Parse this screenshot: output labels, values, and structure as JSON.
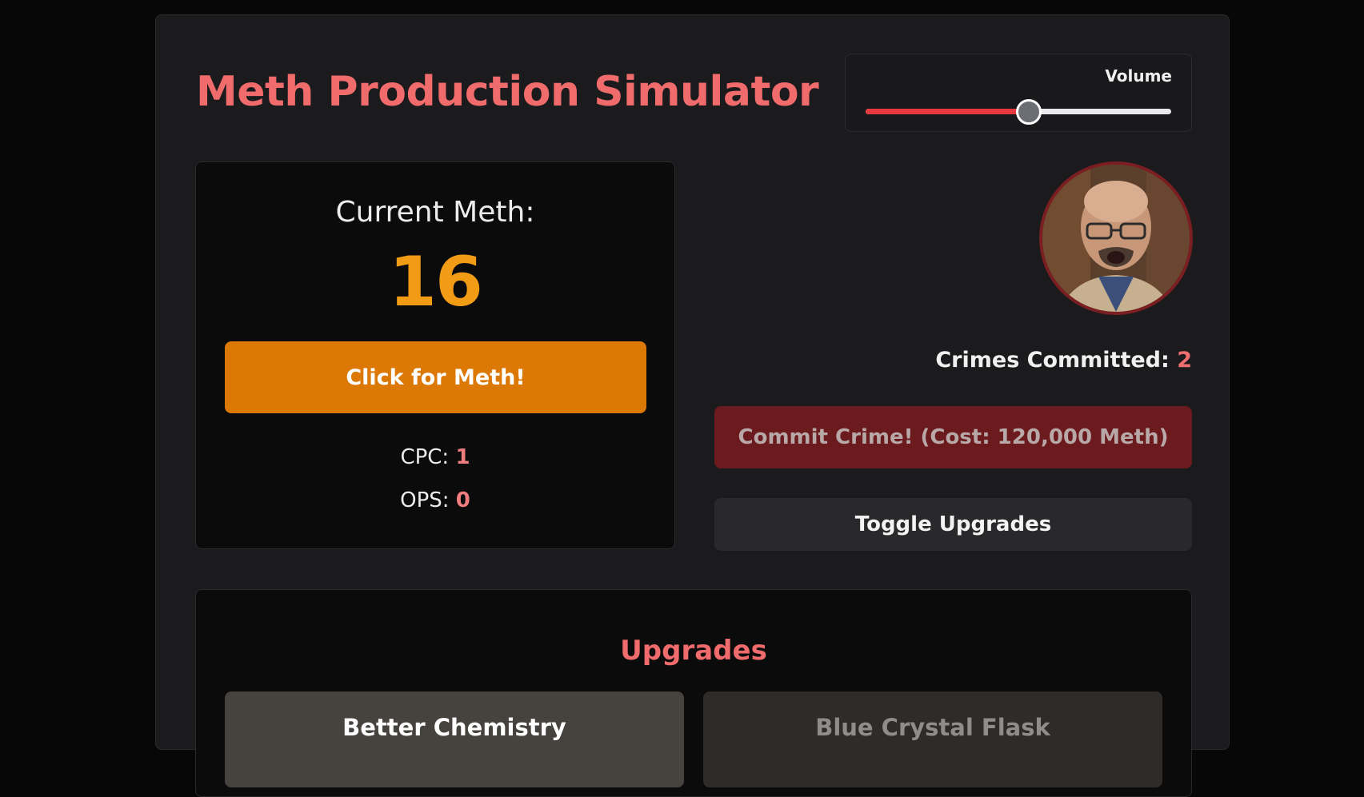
{
  "header": {
    "title": "Meth Production Simulator"
  },
  "volume": {
    "label": "Volume",
    "level": 0.53,
    "fill_color": "#e8393f"
  },
  "meth": {
    "label": "Current Meth:",
    "value": "16",
    "click_button_label": "Click for Meth!",
    "cpc_label": "CPC: ",
    "cpc_value": "1",
    "ops_label": "OPS: ",
    "ops_value": "0"
  },
  "avatar": {
    "icon": "character-portrait",
    "border_color": "#7a1e22"
  },
  "crimes": {
    "label": "Crimes Committed: ",
    "value": "2",
    "commit_button_label": "Commit Crime! (Cost: 120,000 Meth)"
  },
  "toggle_button_label": "Toggle Upgrades",
  "upgrades": {
    "title": "Upgrades",
    "items": [
      {
        "name": "Better Chemistry",
        "state": "affordable"
      },
      {
        "name": "Blue Crystal Flask",
        "state": "locked"
      }
    ]
  },
  "colors": {
    "accent_red": "#f06b6b",
    "meth_orange": "#f29b14",
    "button_orange": "#db7806",
    "crime_button": "#6b1a1e"
  }
}
